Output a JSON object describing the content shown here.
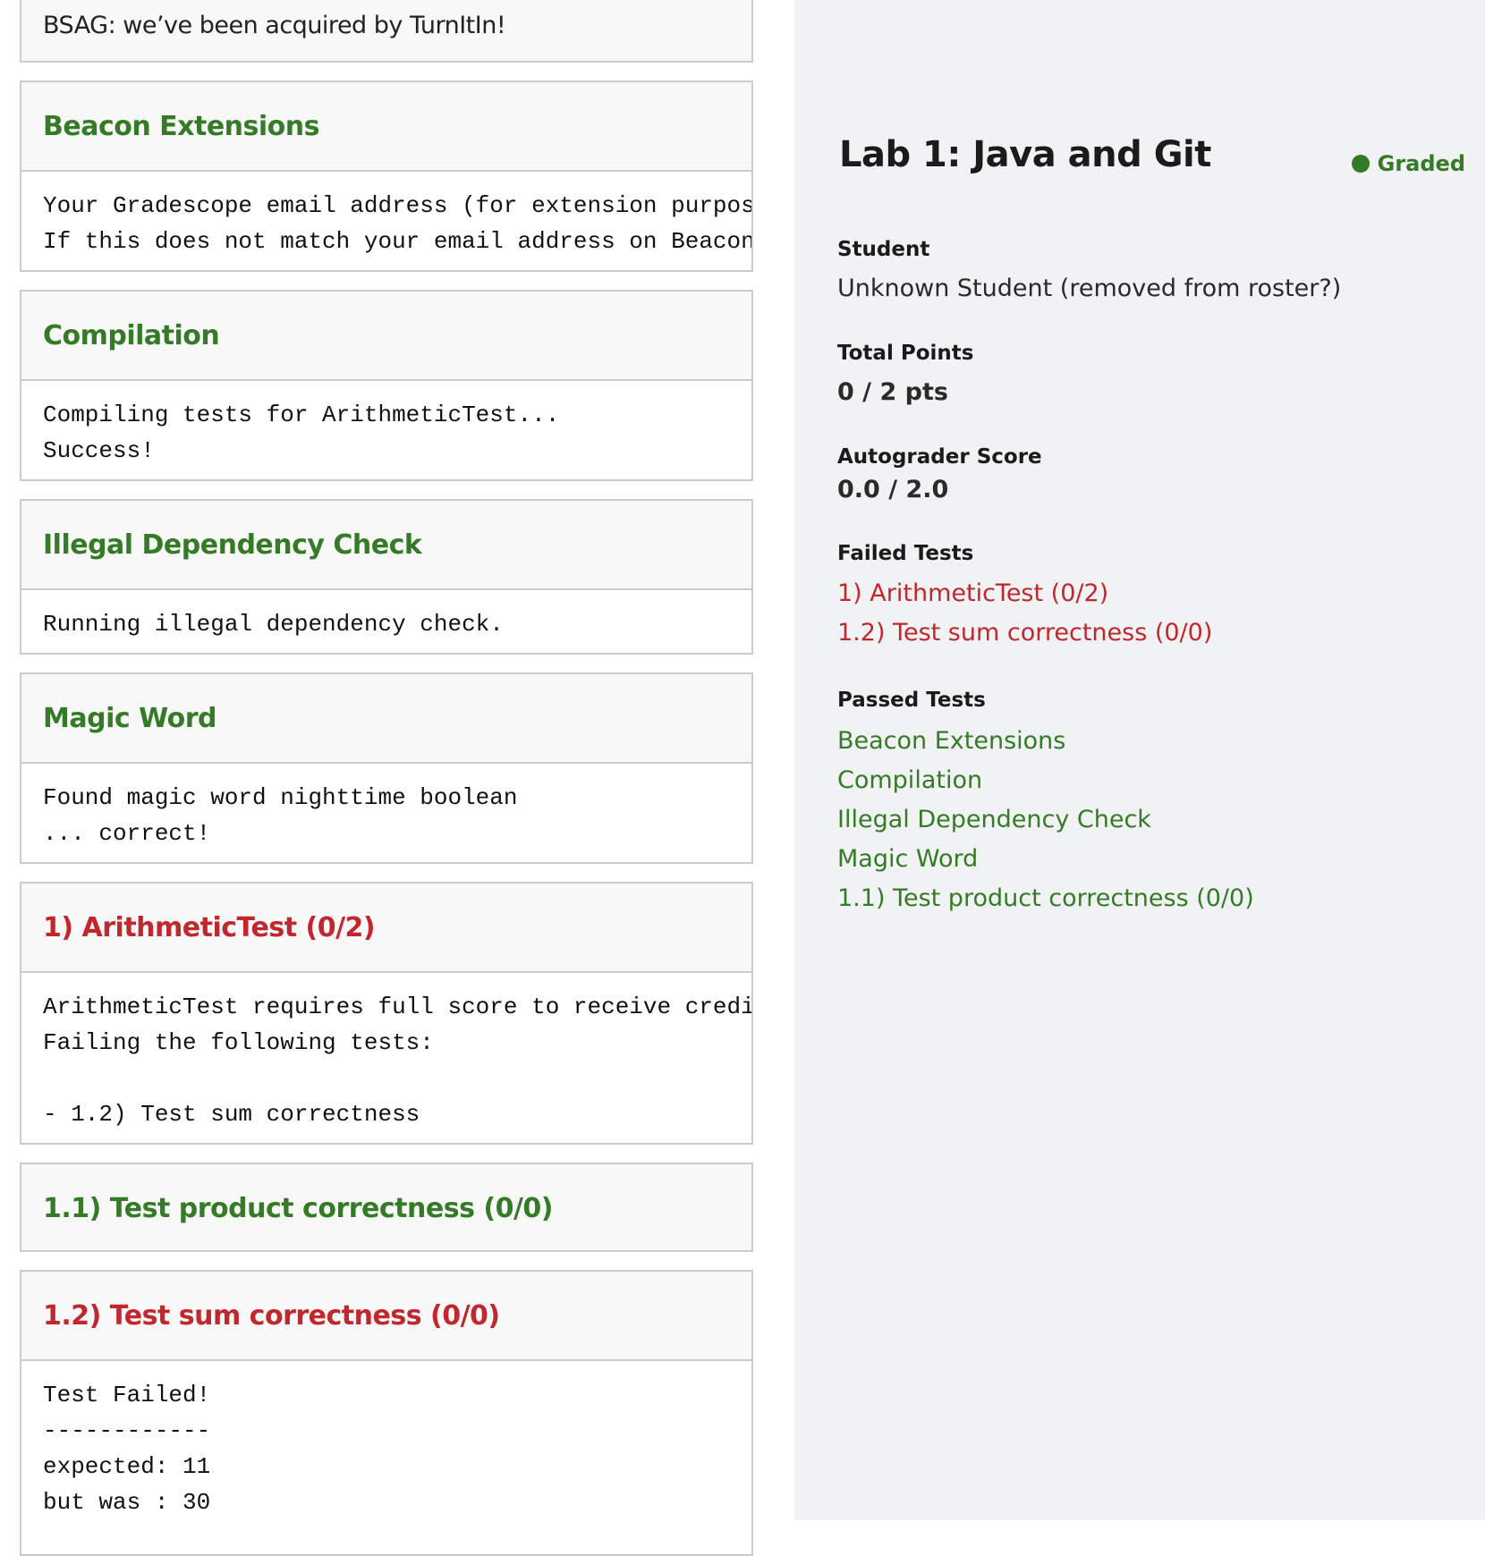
{
  "colors": {
    "pass": "#357a26",
    "fail": "#c1272d",
    "panel_bg": "#f1f2f4",
    "header_bg": "#f8f8f8",
    "border": "#cbcbcb"
  },
  "output_sections": [
    {
      "title": "BSAG: we’ve been acquired by TurnItIn!",
      "status": "plain",
      "body": null
    },
    {
      "title": "Beacon Extensions",
      "status": "pass",
      "body": "Your Gradescope email address (for extension purposes) ...\nIf this does not match your email address on Beacon ..."
    },
    {
      "title": "Compilation",
      "status": "pass",
      "body": "Compiling tests for ArithmeticTest...\nSuccess!"
    },
    {
      "title": "Illegal Dependency Check",
      "status": "pass",
      "body": "Running illegal dependency check."
    },
    {
      "title": "Magic Word",
      "status": "pass",
      "body": "Found magic word nighttime boolean\n... correct!"
    },
    {
      "title": "1) ArithmeticTest (0/2)",
      "status": "fail",
      "body": "ArithmeticTest requires full score to receive credit.\nFailing the following tests:\n\n- 1.2) Test sum correctness"
    },
    {
      "title": "1.1) Test product correctness (0/0)",
      "status": "pass",
      "body": null
    },
    {
      "title": "1.2) Test sum correctness (0/0)",
      "status": "fail",
      "body": "Test Failed!\n------------\nexpected: 11\nbut was : 30"
    }
  ],
  "sidebar": {
    "assignment_title": "Lab 1: Java and Git",
    "status": {
      "icon": "status-dot-icon",
      "label": "Graded"
    },
    "student_label": "Student",
    "student_value": "Unknown Student (removed from roster?)",
    "total_points_label": "Total Points",
    "total_points_value": "0 / 2 pts",
    "autograder_label": "Autograder Score",
    "autograder_value": "0.0 / 2.0",
    "failed_label": "Failed Tests",
    "failed_tests": [
      "1) ArithmeticTest (0/2)",
      "1.2) Test sum correctness (0/0)"
    ],
    "passed_label": "Passed Tests",
    "passed_tests": [
      "Beacon Extensions",
      "Compilation",
      "Illegal Dependency Check",
      "Magic Word",
      "1.1) Test product correctness (0/0)"
    ]
  }
}
